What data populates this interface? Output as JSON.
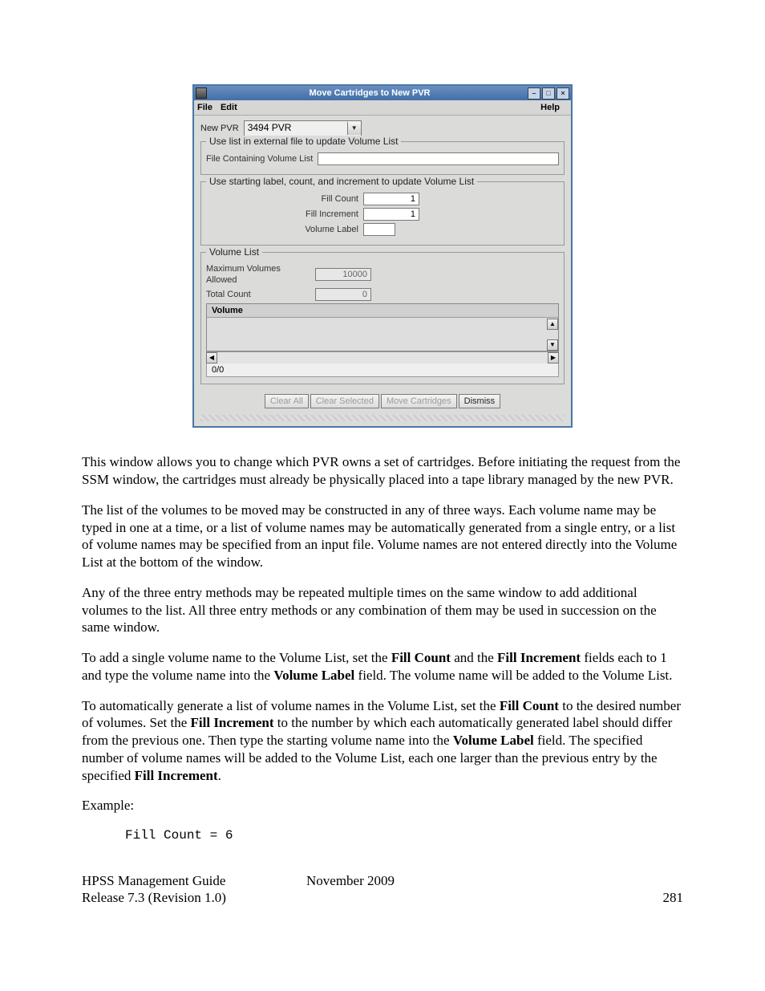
{
  "dialog": {
    "title": "Move Cartridges to New PVR",
    "menubar": {
      "file": "File",
      "edit": "Edit",
      "help": "Help"
    },
    "new_pvr_label": "New PVR",
    "new_pvr_value": "3494 PVR",
    "group_file": {
      "legend": "Use list in external file to update Volume List",
      "file_label": "File Containing Volume List",
      "file_value": ""
    },
    "group_fill": {
      "legend": "Use starting label, count, and increment to update Volume List",
      "fill_count_label": "Fill Count",
      "fill_count_value": "1",
      "fill_incr_label": "Fill Increment",
      "fill_incr_value": "1",
      "vol_label_label": "Volume Label",
      "vol_label_value": ""
    },
    "group_list": {
      "legend": "Volume List",
      "max_label": "Maximum Volumes Allowed",
      "max_value": "10000",
      "total_label": "Total Count",
      "total_value": "0",
      "col_header": "Volume",
      "counter": "0/0"
    },
    "buttons": {
      "clear_all": "Clear All",
      "clear_selected": "Clear Selected",
      "move": "Move Cartridges",
      "dismiss": "Dismiss"
    }
  },
  "text": {
    "p1": "This window allows you to change which PVR owns a set of cartridges. Before initiating the request from the SSM window, the cartridges must already be physically placed into a tape library managed by the new PVR.",
    "p2": "The list of the volumes to be moved may be constructed in any of three ways. Each volume name may be typed in one at a time, or a list of volume names may be automatically generated from a single entry, or a list of volume names may be specified from an input file. Volume names are not entered directly into the Volume List at the bottom of the window.",
    "p3": "Any of the three entry methods may be repeated multiple times on the same window to add additional volumes to the list. All three entry methods or any combination of them may be used in succession on the same window.",
    "p4a": "To add a single volume name to the Volume List, set the ",
    "p4b": "Fill Count",
    "p4c": " and the ",
    "p4d": "Fill Increment",
    "p4e": " fields each to 1 and type the volume name into the ",
    "p4f": "Volume Label",
    "p4g": " field. The volume name will be added to the Volume List.",
    "p5a": "To automatically generate a list of volume names in the Volume List, set the ",
    "p5b": "Fill Count",
    "p5c": " to the desired number of volumes. Set the ",
    "p5d": "Fill Increment",
    "p5e": " to the number by which each automatically generated label should differ from the previous one. Then type the starting volume name into the ",
    "p5f": "Volume Label",
    "p5g": " field. The specified number of volume names will be added to the Volume List, each one larger than the previous entry by the specified ",
    "p5h": "Fill Increment",
    "p5i": ".",
    "example_label": "Example:",
    "example_code": "Fill Count = 6"
  },
  "footer": {
    "guide": "HPSS Management Guide",
    "date": "November 2009",
    "release": "Release 7.3 (Revision 1.0)",
    "page": "281"
  }
}
